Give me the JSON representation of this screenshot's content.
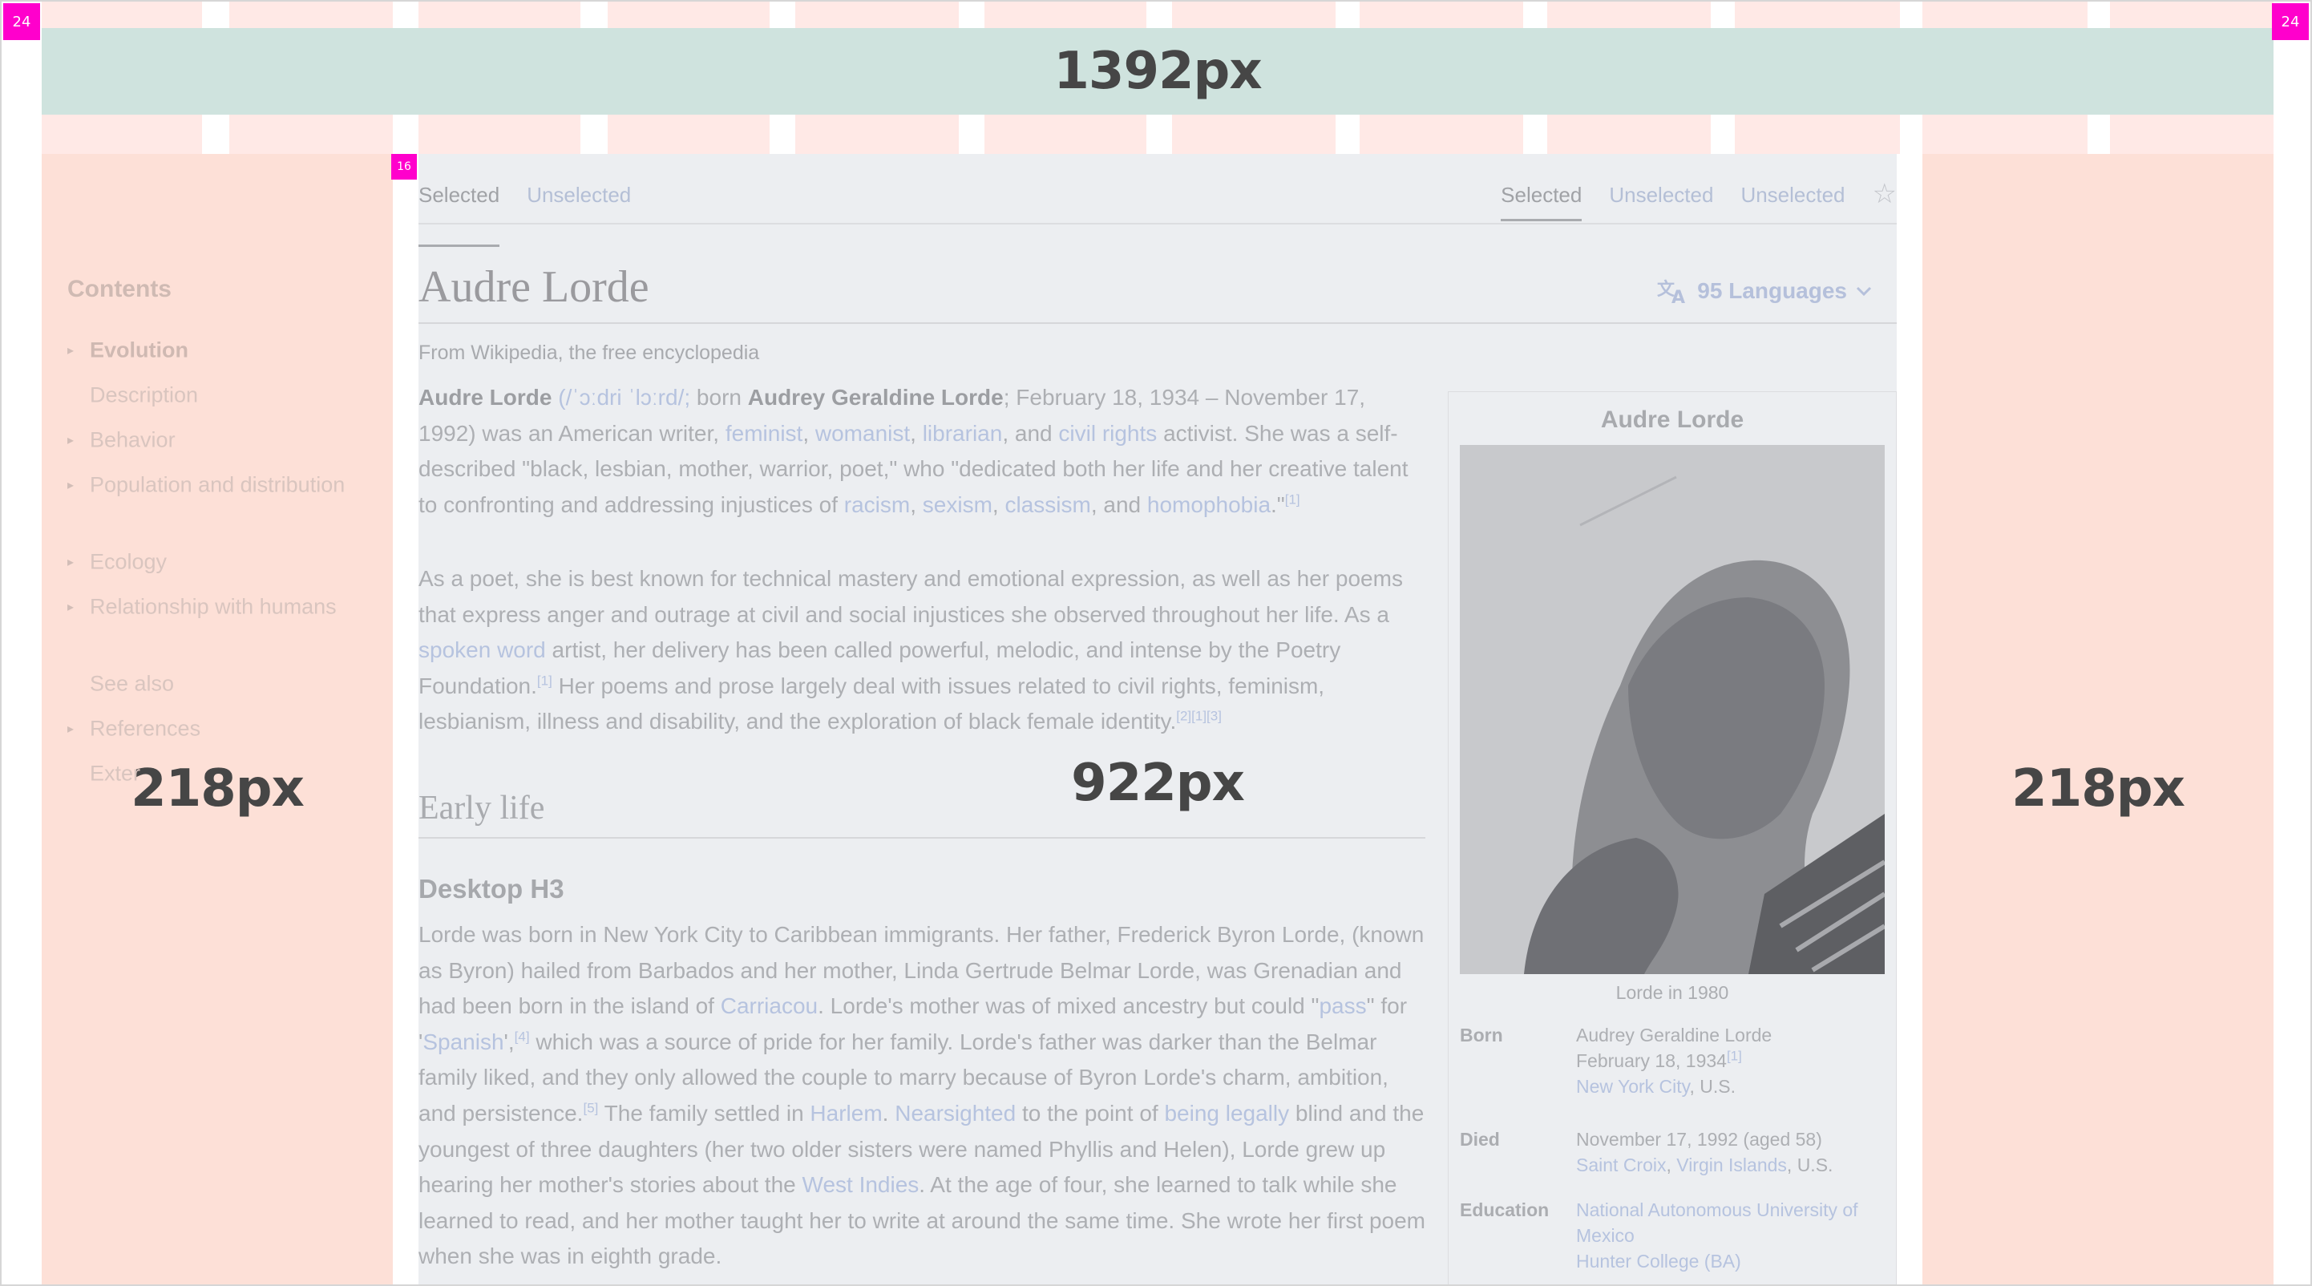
{
  "overlay": {
    "margin_marker_left": "24",
    "margin_marker_right": "24",
    "gutter_marker": "16",
    "content_width_label": "1392px",
    "left_column_label": "218px",
    "main_column_label": "922px",
    "right_column_label": "218px"
  },
  "colors": {
    "column_overlay": "#fde0d7",
    "content_width_bar": "#cfe3de",
    "marker": "#ff00cc"
  },
  "toc": {
    "title": "Contents",
    "items": [
      {
        "label": "Evolution",
        "arrow": "▸"
      },
      {
        "label": "Description",
        "arrow": ""
      },
      {
        "label": "Behavior",
        "arrow": "▸"
      },
      {
        "label": "Population and distribution",
        "arrow": "▸"
      },
      {
        "label": "Ecology",
        "arrow": "▸"
      },
      {
        "label": "Relationship with humans",
        "arrow": "▸"
      },
      {
        "label": "See also",
        "arrow": ""
      },
      {
        "label": "References",
        "arrow": "▸"
      },
      {
        "label": "Exter",
        "arrow": ""
      }
    ]
  },
  "tabs": {
    "left": [
      "Selected",
      "Unselected"
    ],
    "right": [
      "Selected",
      "Unselected",
      "Unselected"
    ],
    "star_icon": "☆"
  },
  "article": {
    "title": "Audre Lorde",
    "languages": "95 Languages",
    "from": "From Wikipedia, the free encyclopedia",
    "p1": {
      "name": "Audre Lorde",
      "ipa": "(/ˈɔːdri ˈlɔːrd/;",
      "born": " born ",
      "birth_name": "Audrey Geraldine Lorde",
      "t1": "; February 18, 1934 – November 17, 1992) was an American writer, ",
      "l1": "feminist",
      "c1": ", ",
      "l2": "womanist",
      "c2": ", ",
      "l3": "librarian",
      "c3": ", and ",
      "l4": "civil rights",
      "t2": " activist. She was a self-described \"black, lesbian, mother, warrior, poet,\" who \"dedicated both her life and her creative talent to confronting and addressing injustices of ",
      "l5": "racism",
      "c5": ", ",
      "l6": "sexism",
      "c6": ", ",
      "l7": "classism",
      "c7": ", and ",
      "l8": "homophobia",
      "end": ".\"",
      "ref": "[1]"
    },
    "p2": {
      "t1": "As a poet, she is best known for technical mastery and emotional expression, as well as her poems that express anger and outrage at civil and social injustices she observed throughout her life. As a ",
      "l1": "spoken word",
      "t2": " artist, her delivery has been called powerful, melodic, and intense by the Poetry Foundation.",
      "r1": "[1]",
      "t3": " Her poems and prose largely deal with issues related to civil rights, feminism, lesbianism, illness and disability, and the exploration of black female identity.",
      "r2": "[2][1][3]"
    },
    "h2": "Early life",
    "h3": "Desktop H3",
    "p3": {
      "t1": "Lorde was born in New York City to Caribbean immigrants. Her father, Frederick Byron Lorde, (known as Byron) hailed from Barbados and her mother, Linda Gertrude Belmar Lorde, was Grenadian and had been born in the island of ",
      "l1": "Carriacou",
      "t2": ". Lorde's mother was of mixed ancestry but could \"",
      "l2": "pass",
      "t3": "\" for '",
      "l3": "Spanish",
      "t4": "',",
      "r1": "[4]",
      "t5": " which was a source of pride for her family. Lorde's father was darker than the Belmar family liked, and they only allowed the couple to marry because of Byron Lorde's charm, ambition, and persistence.",
      "r2": "[5]",
      "t6": " The family settled in ",
      "l4": "Harlem",
      "t7": ". ",
      "l5": "Nearsighted",
      "t8": " to the point of ",
      "l6": "being legally",
      "t9": " blind and the youngest of three daughters (her two older sisters were named Phyllis and Helen), Lorde grew up hearing her mother's stories about the ",
      "l7": "West Indies",
      "t10": ". At the age of four, she learned to talk while she learned to read, and her mother taught her to write at around the same time. She wrote her first poem when she was in eighth grade."
    }
  },
  "infobox": {
    "title": "Audre Lorde",
    "caption": "Lorde in 1980",
    "born_label": "Born",
    "born_name": "Audrey Geraldine Lorde",
    "born_date": "February 18, 1934",
    "born_ref": "[1]",
    "born_place_link": "New York City",
    "born_place_rest": ", U.S.",
    "died_label": "Died",
    "died_date": "November 17, 1992 (aged 58)",
    "died_link1": "Saint Croix",
    "died_sep": ", ",
    "died_link2": "Virgin Islands",
    "died_rest": ", U.S.",
    "edu_label": "Education",
    "edu_1": "National Autonomous University of Mexico",
    "edu_2": "Hunter College (BA)"
  }
}
